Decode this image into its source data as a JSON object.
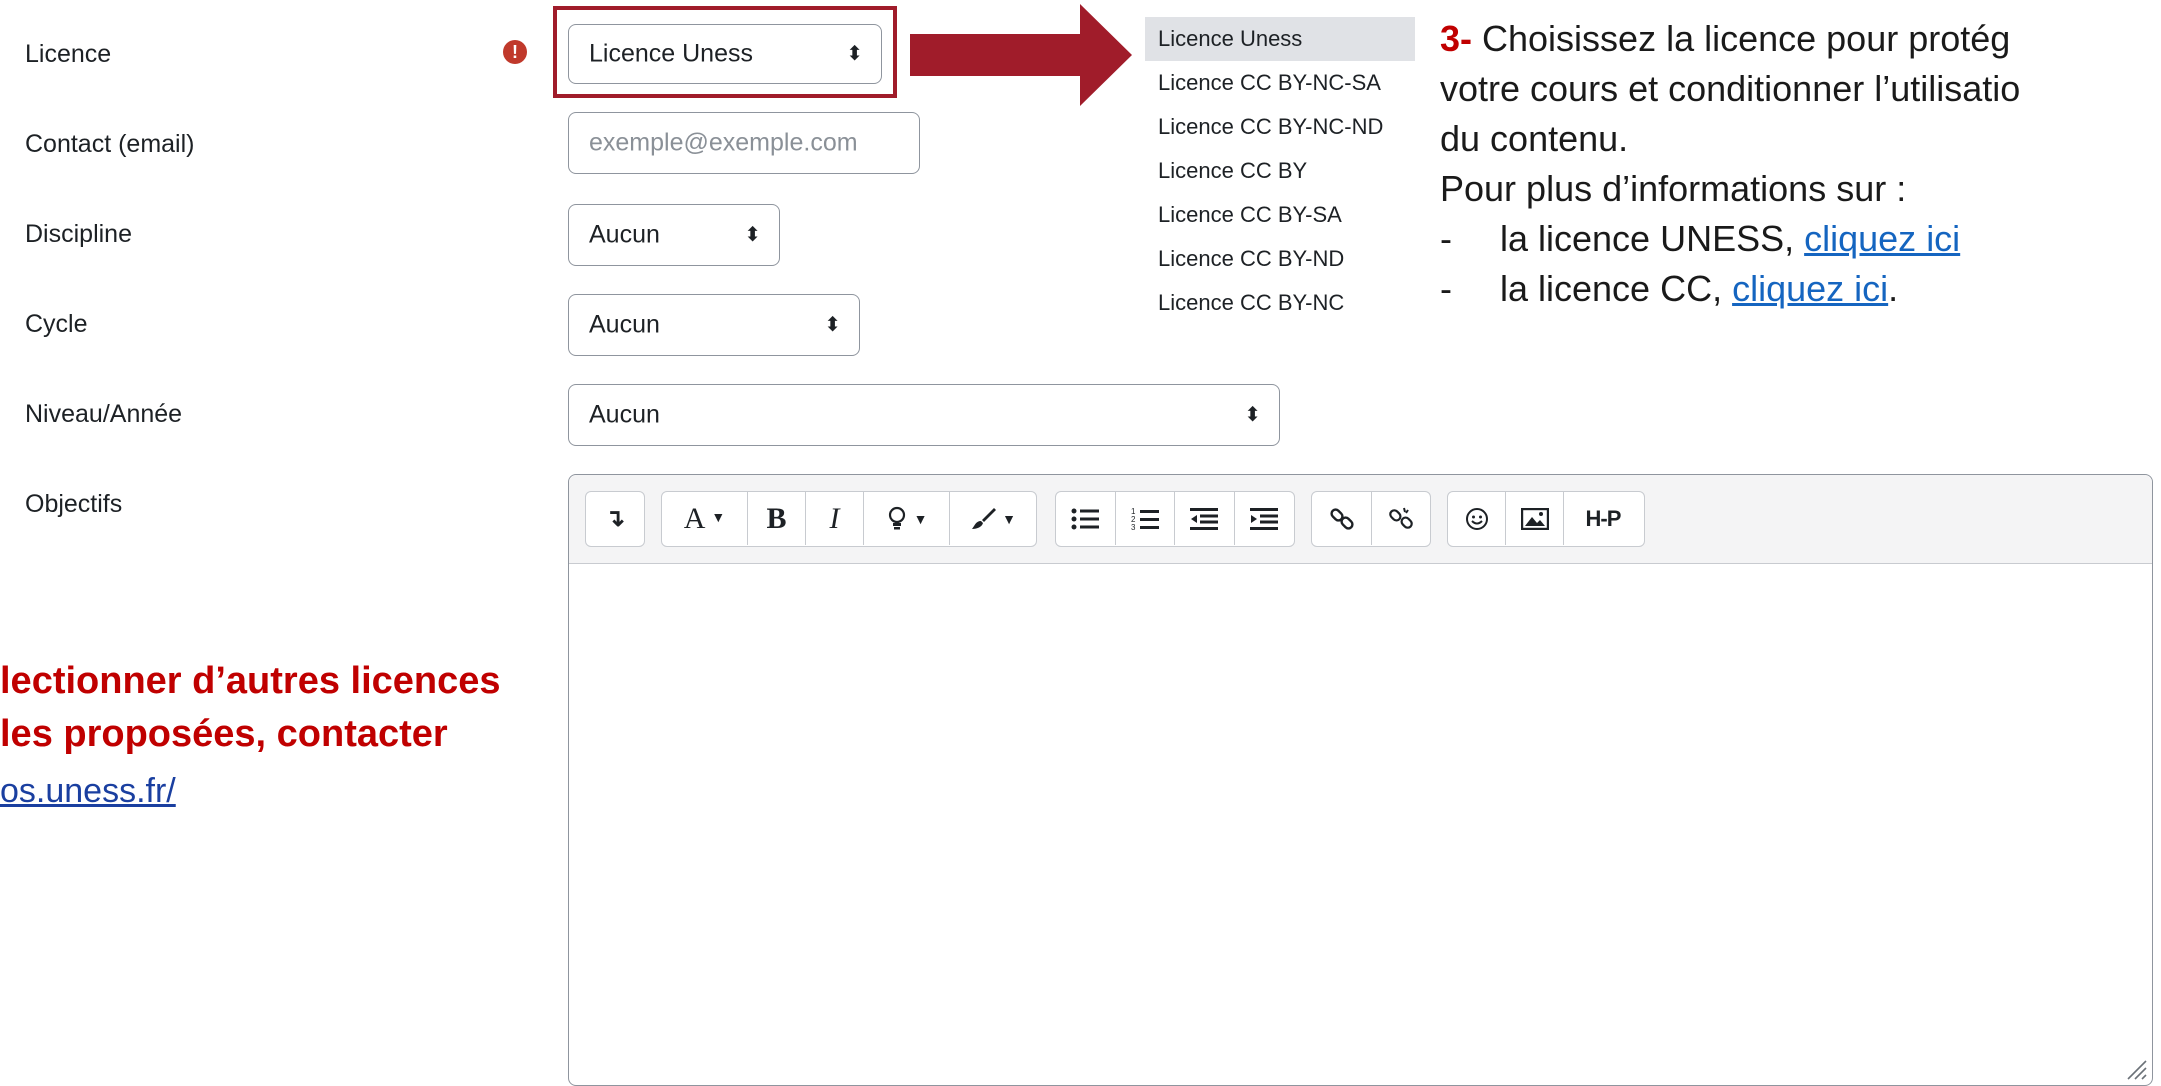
{
  "form": {
    "licence_label": "Licence",
    "licence_value": "Licence Uness",
    "contact_label": "Contact (email)",
    "contact_placeholder": "exemple@exemple.com",
    "discipline_label": "Discipline",
    "discipline_value": "Aucun",
    "cycle_label": "Cycle",
    "cycle_value": "Aucun",
    "niveau_label": "Niveau/Année",
    "niveau_value": "Aucun",
    "objectifs_label": "Objectifs"
  },
  "licence_options": [
    "Licence Uness",
    "Licence CC BY-NC-SA",
    "Licence CC BY-NC-ND",
    "Licence CC BY",
    "Licence CC BY-SA",
    "Licence CC BY-ND",
    "Licence CC BY-NC"
  ],
  "annotation": {
    "number": "3-",
    "line1": " Choisissez la licence pour protég",
    "line2": "votre cours et conditionner l’utilisatio",
    "line3": "du contenu.",
    "line4": "Pour plus d’informations sur :",
    "item1_prefix": "la licence UNESS, ",
    "item1_link": "cliquez ici",
    "item2_prefix": "la licence CC, ",
    "item2_link": "cliquez ici",
    "item2_suffix": "."
  },
  "side_note": {
    "line1": "lectionner d’autres licences",
    "line2": "les proposées,  contacter",
    "link": "os.uness.fr/"
  },
  "toolbar": {
    "font_label": "A",
    "bold_label": "B",
    "italic_label": "I",
    "h5p_label": "H-P"
  },
  "icons": [
    "required-icon",
    "select-arrow-icon",
    "show-more-icon",
    "font-icon",
    "bold-icon",
    "italic-icon",
    "lightbulb-icon",
    "brush-icon",
    "bullet-list-icon",
    "numbered-list-icon",
    "outdent-icon",
    "indent-icon",
    "link-icon",
    "unlink-icon",
    "emoji-icon",
    "image-icon",
    "h5p-icon",
    "resize-handle-icon"
  ],
  "colors": {
    "accent_red": "#c00000",
    "arrow_red": "#a01c2a",
    "highlight_border": "#a01c2a",
    "link_blue": "#1565c0",
    "required_red": "#c0392b"
  }
}
